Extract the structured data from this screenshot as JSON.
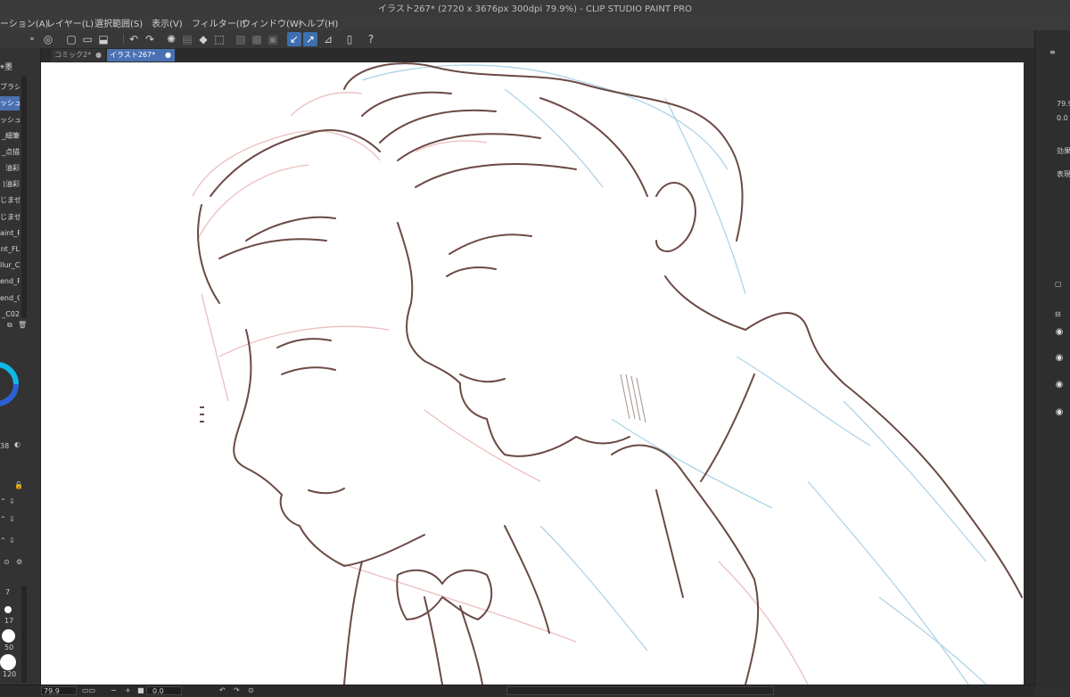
{
  "window": {
    "title": "イラスト267* (2720 x 3676px 300dpi 79.9%)  - CLIP STUDIO PAINT PRO"
  },
  "menu": [
    {
      "label": "ーション(A)"
    },
    {
      "label": "レイヤー(L)"
    },
    {
      "label": "選択範囲(S)"
    },
    {
      "label": "表示(V)"
    },
    {
      "label": "フィルター(I)"
    },
    {
      "label": "ウィンドウ(W)"
    },
    {
      "label": "ヘルプ(H)"
    }
  ],
  "tabs": [
    {
      "label": "コミック2*",
      "active": false
    },
    {
      "label": "イラスト267*",
      "active": true
    }
  ],
  "brush_panel": {
    "header": "墨",
    "items": [
      "ブラシ",
      "ッシュ",
      "ッシュ",
      "_細筆",
      "_点描",
      "油彩",
      ")油彩",
      "じませ",
      "じませ",
      "aint_R",
      "nt_FL",
      "llur_C",
      "end_R",
      "end_C",
      "_C02"
    ],
    "selected_index": 1
  },
  "color_panel": {
    "value": "38"
  },
  "size_panel": {
    "sizes": [
      "7",
      "17",
      "50",
      "120"
    ]
  },
  "right_panel": {
    "zoom": "79.9",
    "angle": "0.0",
    "label_effect": "効果",
    "label_display": "表現"
  },
  "status": {
    "zoom": "79.9",
    "angle": "0.0"
  },
  "colors": {
    "accent": "#4a72b3",
    "panel": "#333333",
    "lineart": "#6b4a44",
    "sketch_blue": "#a8d0e6",
    "sketch_red": "#e8b9b9"
  }
}
